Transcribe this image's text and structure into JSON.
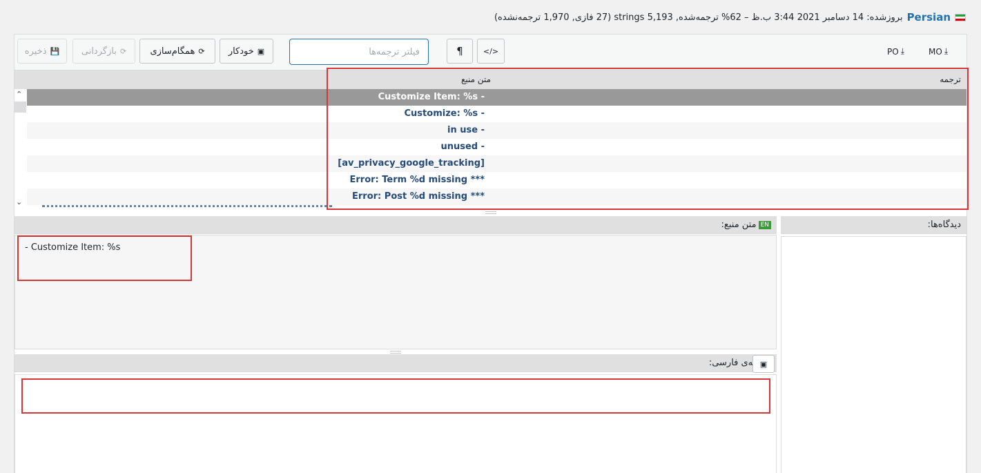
{
  "header": {
    "flag_icon": "iran-flag-icon",
    "language": "Persian",
    "stats": "بروزشده: 14 دسامبر 2021 3:44 ب.ظ – 62% ترجمه‌شده, 5,193 strings (27 فازی, 1,970 ترجمه‌نشده)"
  },
  "toolbar": {
    "save_label": "ذخیره",
    "revert_label": "بازگردانی",
    "sync_label": "همگام‌سازی",
    "auto_label": "خودکار",
    "filter_placeholder": "فیلتر ترجمه‌ها",
    "pilcrow_label": "¶",
    "code_label": "</>",
    "po_label": "PO",
    "mo_label": "MO"
  },
  "grid": {
    "source_header": "متن منبع",
    "translation_header": "ترجمه",
    "rows": [
      "Customize Item: %s -",
      "Customize: %s -",
      "in use -",
      "unused -",
      "[av_privacy_google_tracking]",
      "Error: Term %d missing ***",
      "Error: Post %d missing ***"
    ]
  },
  "source_panel": {
    "badge": "EN",
    "label": "متن منبع:",
    "text": "- Customize Item: %s"
  },
  "target_panel": {
    "label": "ترجمه‌ی فارسی:",
    "value": ""
  },
  "comments_panel": {
    "label": "دیدگاه‌ها:"
  },
  "colors": {
    "accent": "#2271b1",
    "source_text": "#264b78",
    "selected_row": "#999999",
    "highlight_box": "#d63638"
  }
}
